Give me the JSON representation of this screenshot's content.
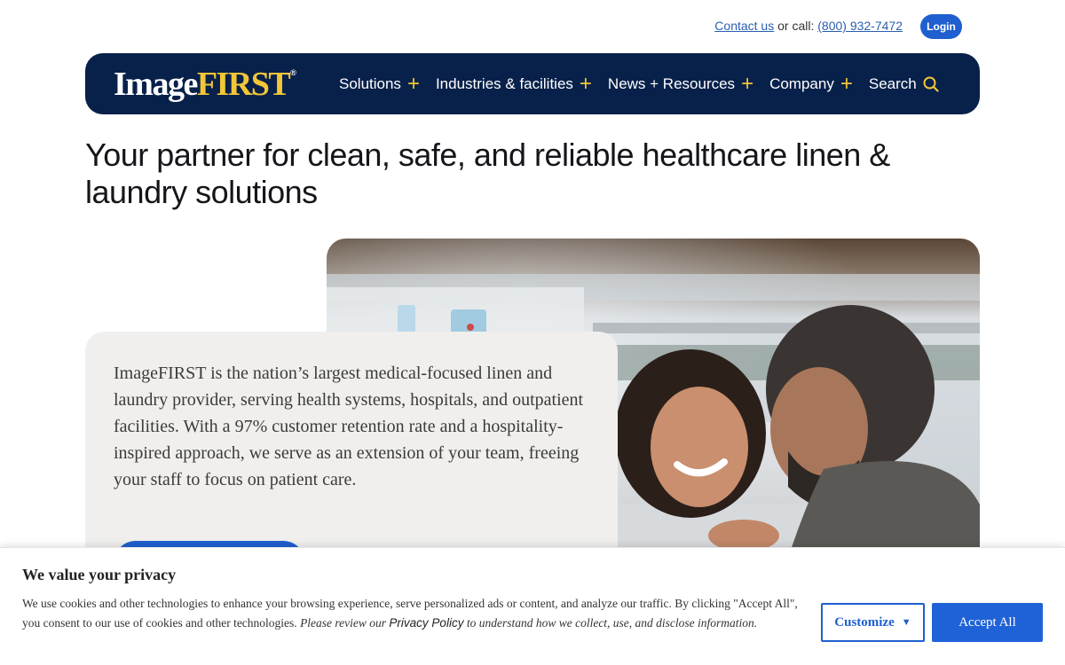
{
  "utility": {
    "contact_link": "Contact us",
    "call_text": "or call:",
    "phone": "(800) 932-7472",
    "login": "Login"
  },
  "nav": {
    "logo_image": "Image",
    "logo_first": "FIRST",
    "logo_reg": "®",
    "items": [
      {
        "label": "Solutions",
        "icon": "plus-icon"
      },
      {
        "label": "Industries & facilities",
        "icon": "plus-icon"
      },
      {
        "label": "News + Resources",
        "icon": "plus-icon"
      },
      {
        "label": "Company",
        "icon": "plus-icon"
      },
      {
        "label": "Search",
        "icon": "search-icon"
      }
    ]
  },
  "hero": {
    "headline": "Your partner for clean, safe, and reliable healthcare linen & laundry solutions",
    "description": "ImageFIRST is the nation’s largest medical-focused linen and laundry provider, serving health systems, hospitals, and outpatient facilities. With a 97% customer retention rate and a hospitality-inspired approach, we serve as an extension of your team, freeing your staff to focus on patient care."
  },
  "cookie": {
    "title": "We value your privacy",
    "text": "We use cookies and other technologies to enhance your browsing experience, serve personalized ads or content, and analyze our traffic. By clicking \"Accept All\", you consent to our use of cookies and other technologies.",
    "italic_before": "Please review our",
    "privacy_link": "Privacy Policy",
    "italic_after": "to understand how we collect, use, and disclose information.",
    "customize": "Customize",
    "accept": "Accept All"
  },
  "colors": {
    "nav_bg": "#08214a",
    "accent_yellow": "#f2c637",
    "primary_blue": "#1f5fcf",
    "card_bg": "#f0efed"
  }
}
